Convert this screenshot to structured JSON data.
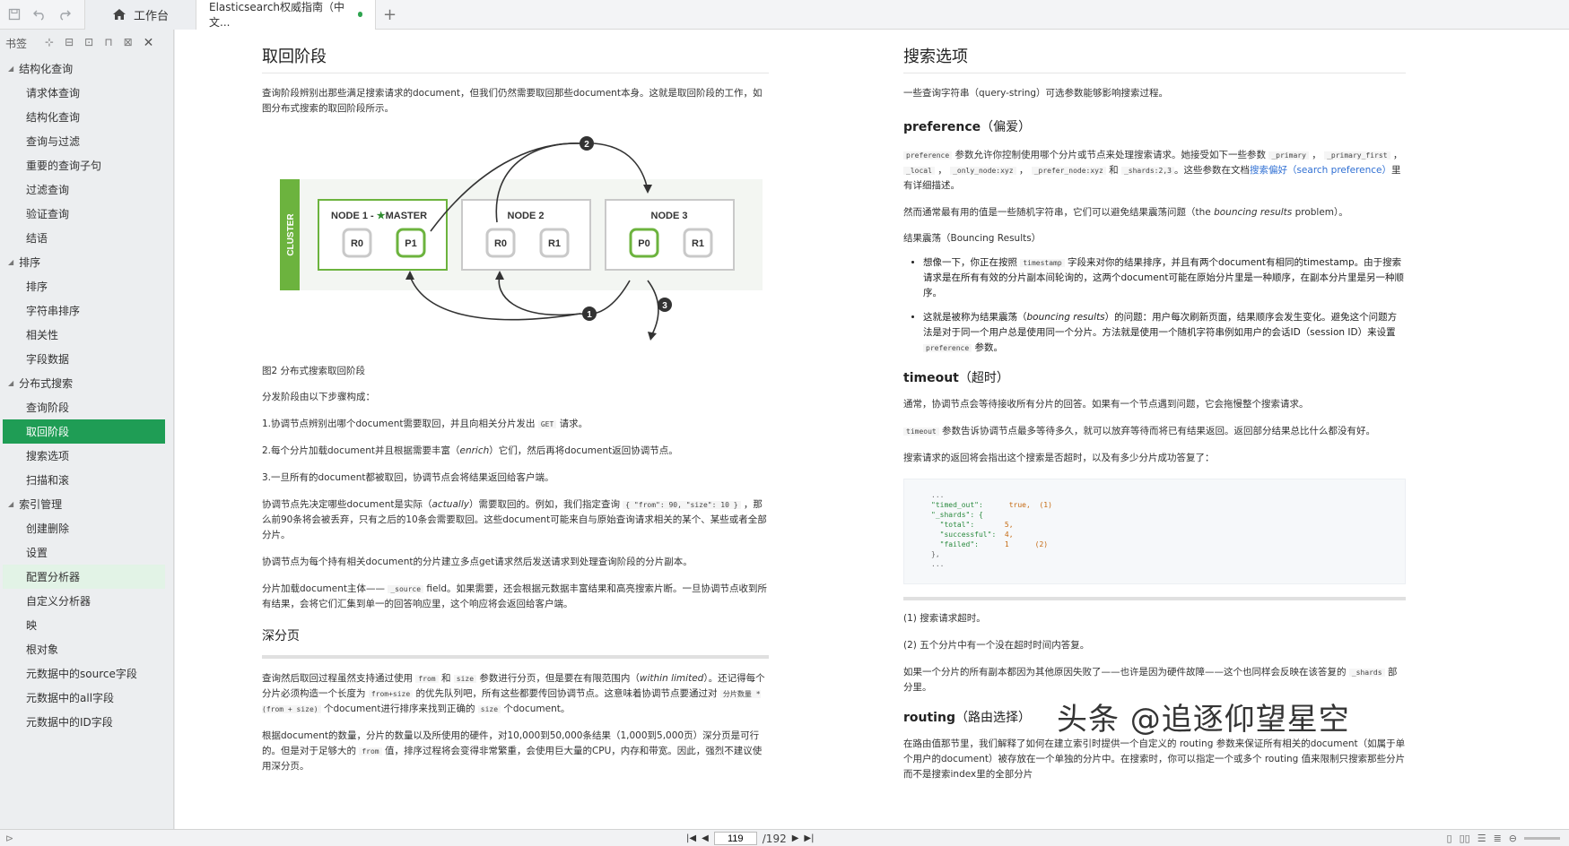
{
  "topbar": {
    "home_tab": "工作台",
    "doc_tab": "Elasticsearch权威指南（中文...",
    "add_tab": "+"
  },
  "sidebar": {
    "title": "书签",
    "items": [
      {
        "label": "结构化查询",
        "level": 0
      },
      {
        "label": "请求体查询",
        "level": 1
      },
      {
        "label": "结构化查询",
        "level": 1
      },
      {
        "label": "查询与过滤",
        "level": 1
      },
      {
        "label": "重要的查询子句",
        "level": 1
      },
      {
        "label": "过滤查询",
        "level": 1
      },
      {
        "label": "验证查询",
        "level": 1
      },
      {
        "label": "结语",
        "level": 1
      },
      {
        "label": "排序",
        "level": 0
      },
      {
        "label": "排序",
        "level": 1
      },
      {
        "label": "字符串排序",
        "level": 1
      },
      {
        "label": "相关性",
        "level": 1
      },
      {
        "label": "字段数据",
        "level": 1
      },
      {
        "label": "分布式搜索",
        "level": 0
      },
      {
        "label": "查询阶段",
        "level": 1
      },
      {
        "label": "取回阶段",
        "level": 1,
        "state": "selected"
      },
      {
        "label": "搜索选项",
        "level": 1
      },
      {
        "label": "扫描和滚",
        "level": 1
      },
      {
        "label": "索引管理",
        "level": 0
      },
      {
        "label": "创建删除",
        "level": 1
      },
      {
        "label": "设置",
        "level": 1
      },
      {
        "label": "配置分析器",
        "level": 1,
        "state": "hover"
      },
      {
        "label": "自定义分析器",
        "level": 1
      },
      {
        "label": "映",
        "level": 1
      },
      {
        "label": "根对象",
        "level": 1
      },
      {
        "label": "元数据中的source字段",
        "level": 1
      },
      {
        "label": "元数据中的all字段",
        "level": 1
      },
      {
        "label": "元数据中的ID字段",
        "level": 1
      }
    ]
  },
  "left": {
    "title": "取回阶段",
    "intro": "查询阶段辨别出那些满足搜索请求的document，但我们仍然需要取回那些document本身。这就是取回阶段的工作，如图分布式搜索的取回阶段所示。",
    "diagram": {
      "cluster": "CLUSTER",
      "node1": "NODE 1 - ",
      "node1b": "MASTER",
      "node2": "NODE 2",
      "node3": "NODE 3",
      "shards": [
        "R0",
        "P1",
        "R0",
        "R1",
        "P0",
        "R1"
      ],
      "steps": [
        "1",
        "2",
        "3"
      ],
      "star": "★"
    },
    "caption": "图2 分布式搜索取回阶段",
    "p_steps_intro": "分发阶段由以下步骤构成：",
    "step1a": "1.协调节点辨别出哪个document需要取回，并且向相关分片发出 ",
    "step1code": "GET",
    "step1b": " 请求。",
    "step2a": "2.每个分片加载document并且根据需要丰富（",
    "step2em": "enrich",
    "step2b": "）它们，然后再将document返回协调节点。",
    "step3": "3.一旦所有的document都被取回，协调节点会将结果返回给客户端。",
    "p4a": "协调节点先决定哪些document是实际（",
    "p4em": "actually",
    "p4b": "）需要取回的。例如，我们指定查询 ",
    "p4code": "{ \"from\": 90, \"size\": 10 }",
    "p4c": " ，那么前90条将会被丢弃，只有之后的10条会需要取回。这些document可能来自与原始查询请求相关的某个、某些或者全部分片。",
    "p5": "协调节点为每个持有相关document的分片建立多点get请求然后发送请求到处理查询阶段的分片副本。",
    "p6a": "分片加载document主体—— ",
    "p6code": "_source",
    "p6b": " field。如果需要，还会根据元数据丰富结果和高亮搜索片断。一旦协调节点收到所有结果，会将它们汇集到单一的回答响应里，这个响应将会返回给客户端。",
    "deep_title": "深分页",
    "p7a": "查询然后取回过程虽然支持通过使用 ",
    "p7code1": "from",
    "p7m1": " 和 ",
    "p7code2": "size",
    "p7b": " 参数进行分页，但是要在有限范围内（",
    "p7em": "within limited",
    "p7c": "）。还记得每个分片必须构造一个长度为 ",
    "p7code3": "from+size",
    "p7d": " 的优先队列吧，所有这些都要传回协调节点。这意味着协调节点要通过对 ",
    "p7code4": "分片数量 * (from + size)",
    "p7e": " 个document进行排序来找到正确的 ",
    "p7code5": "size",
    "p7f": " 个document。",
    "p8a": "根据document的数量，分片的数量以及所使用的硬件，对10,000到50,000条结果（1,000到5,000页）深分页是可行的。但是对于足够大的 ",
    "p8code": "from",
    "p8b": " 值，排序过程将会变得非常繁重，会使用巨大量的CPU，内存和带宽。因此，强烈不建议使用深分页。"
  },
  "right": {
    "title": "搜索选项",
    "intro": "一些查询字符串（query-string）可选参数能够影响搜索过程。",
    "pref_title": "preference",
    "pref_title_cn": "（偏爱）",
    "pref_p1_code": "preference",
    "pref_p1a": " 参数允许你控制使用哪个分片或节点来处理搜索请求。她接受如下一些参数 ",
    "pref_opts": [
      "_primary",
      "_primary_first",
      "_local",
      "_only_node:xyz",
      "_prefer_node:xyz",
      "_shards:2,3"
    ],
    "pref_sep": " ， ",
    "pref_and": " 和 ",
    "pref_p1b": "。这些参数在文档",
    "pref_link": "搜索偏好（search preference）",
    "pref_p1c": "里有详细描述。",
    "pref_p2a": "然而通常最有用的值是一些随机字符串，它们可以避免结果震荡问题（the ",
    "pref_p2em": "bouncing results",
    "pref_p2b": " problem）。",
    "bounce_title": "结果震荡（Bouncing Results）",
    "bullet1a": "想像一下，你正在按照 ",
    "bullet1code": "timestamp",
    "bullet1b": " 字段来对你的结果排序，并且有两个document有相同的timestamp。由于搜索请求是在所有有效的分片副本间轮询的，这两个document可能在原始分片里是一种顺序，在副本分片里是另一种顺序。",
    "bullet2a": "这就是被称为结果震荡（",
    "bullet2em": "bouncing results",
    "bullet2b": "）的问题：用户每次刷新页面，结果顺序会发生变化。避免这个问题方法是对于同一个用户总是使用同一个分片。方法就是使用一个随机字符串例如用户的会话ID（session ID）来设置 ",
    "bullet2code": "preference",
    "bullet2c": " 参数。",
    "timeout_title": "timeout",
    "timeout_title_cn": "（超时）",
    "timeout_p1": "通常，协调节点会等待接收所有分片的回答。如果有一个节点遇到问题，它会拖慢整个搜索请求。",
    "timeout_p2code": "timeout",
    "timeout_p2": " 参数告诉协调节点最多等待多久，就可以放弃等待而将已有结果返回。返回部分结果总比什么都没有好。",
    "timeout_p3": "搜索请求的返回将会指出这个搜索是否超时，以及有多少分片成功答复了：",
    "code": {
      "line0": "...",
      "timed_out_k": "\"timed_out\":",
      "timed_out_v": "true,",
      "c1": "(1)",
      "shards_k": "\"_shards\": {",
      "total_k": "\"total\":",
      "total_v": "5,",
      "succ_k": "\"successful\":",
      "succ_v": "4,",
      "failed_k": "\"failed\":",
      "failed_v": "1",
      "c2": "(2)",
      "close": "},",
      "end": "..."
    },
    "note1": "(1) 搜索请求超时。",
    "note2": "(2) 五个分片中有一个没在超时时间内答复。",
    "p_fail_a": "如果一个分片的所有副本都因为其他原因失败了——也许是因为硬件故障——这个也同样会反映在该答复的 ",
    "p_fail_code": "_shards",
    "p_fail_b": " 部分里。",
    "routing_title": "routing",
    "routing_title_cn": "（路由选择）",
    "routing_p": "在路由值那节里，我们解释了如何在建立索引时提供一个自定义的 routing 参数来保证所有相关的document（如属于单个用户的document）被存放在一个单独的分片中。在搜索时，你可以指定一个或多个 routing 值来限制只搜索那些分片而不是搜索index里的全部分片"
  },
  "watermark": "头条 @追逐仰望星空",
  "pager": {
    "current": "119",
    "total": "/192"
  }
}
